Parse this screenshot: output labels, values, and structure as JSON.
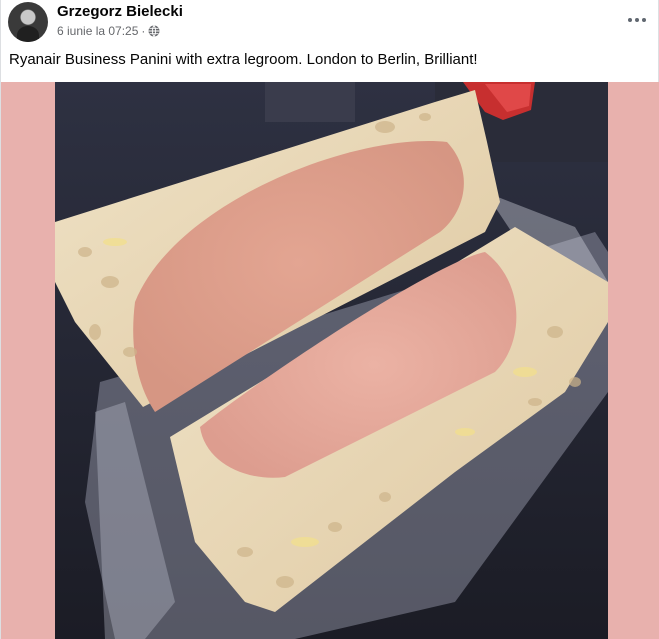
{
  "post": {
    "author": "Grzegorz Bielecki",
    "date": "6 iunie la 07:25",
    "separator": "·",
    "privacy_icon": "globe-icon",
    "more_icon": "more-horizontal-icon",
    "caption": "Ryanair Business Panini with extra legroom. London to Berlin, Brilliant!"
  },
  "colors": {
    "side_panel": "#e8b1ad",
    "author_text": "#050505",
    "meta_text": "#65676b"
  }
}
